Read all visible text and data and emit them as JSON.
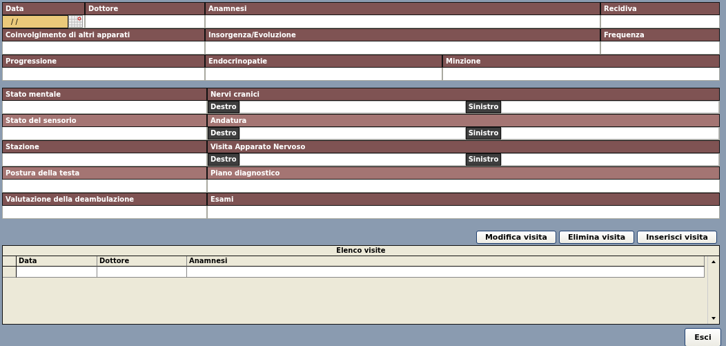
{
  "sections": [
    {
      "fields": [
        {
          "label": "Data",
          "color": "#7f5353",
          "kind": "date",
          "value": "/ /"
        },
        {
          "label": "Dottore",
          "color": "#7f5353",
          "kind": "text"
        },
        {
          "label": "Anamnesi",
          "color": "#7f5353",
          "kind": "text"
        },
        {
          "label": "Recidiva",
          "color": "#7f5353",
          "kind": "text"
        },
        {
          "label": "Coinvolgimento di altri apparati",
          "color": "#7f5353",
          "kind": "text"
        },
        {
          "label": "Insorgenza/Evoluzione",
          "color": "#7f5353",
          "kind": "text"
        },
        {
          "label": "Frequenza",
          "color": "#7f5353",
          "kind": "text"
        },
        {
          "label": "Progressione",
          "color": "#7f5353",
          "kind": "text"
        },
        {
          "label": "Endocrinopatie",
          "color": "#7f5353",
          "kind": "text"
        },
        {
          "label": "Minzione",
          "color": "#7f5353",
          "kind": "text"
        }
      ]
    },
    {
      "fields": [
        {
          "label": "Stato mentale",
          "color": "#7f5353",
          "kind": "text"
        },
        {
          "label": "Nervi cranici",
          "color": "#7f5353",
          "kind": "sides",
          "sides": [
            "Destro",
            "Sinistro"
          ]
        },
        {
          "label": "Stato del sensorio",
          "color": "#a47573",
          "kind": "text"
        },
        {
          "label": "Andatura",
          "color": "#a47573",
          "kind": "sides",
          "sides": [
            "Destro",
            "Sinistro"
          ]
        },
        {
          "label": "Stazione",
          "color": "#7f5353",
          "kind": "text"
        },
        {
          "label": "Visita Apparato Nervoso",
          "color": "#7f5353",
          "kind": "sides",
          "sides": [
            "Destro",
            "Sinistro"
          ]
        },
        {
          "label": "Postura della testa",
          "color": "#a47573",
          "kind": "text"
        },
        {
          "label": "Piano diagnostico",
          "color": "#a47573",
          "kind": "text"
        },
        {
          "label": "Valutazione della deambulazione",
          "color": "#7f5353",
          "kind": "text"
        },
        {
          "label": "Esami",
          "color": "#7f5353",
          "kind": "text"
        }
      ]
    }
  ],
  "actions": [
    "Modifica visita",
    "Elimina visita",
    "Inserisci visita"
  ],
  "visits": {
    "title": "Elenco visite",
    "columns": [
      "Data",
      "Dottore",
      "Anamnesi"
    ]
  },
  "exit_button": "Esci"
}
